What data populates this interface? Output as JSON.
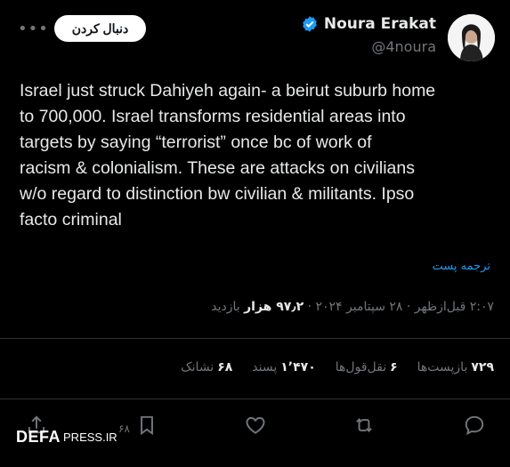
{
  "header": {
    "name": "Noura Erakat",
    "handle": "@4noura",
    "follow_label": "دنبال کردن",
    "more": "•••"
  },
  "tweet": {
    "text": "Israel just struck Dahiyeh again- a beirut suburb home\nto 700,000. Israel transforms residential areas into\ntargets by saying “terrorist” once bc of work of\nracism & colonialism. These are attacks on civilians\nw/o regard to distinction bw civilian & militants. Ipso\nfacto criminal",
    "translate_label": "ترجمه پست"
  },
  "meta": {
    "time_date": "۲:۰۷ قبل‌ازظهر · ۲۸ سپتامبر ۲۰۲۴ · ",
    "views_value": "۹۷٫۲ هزار",
    "views_label": " بازدید"
  },
  "stats": {
    "reposts_value": "۷۲۹",
    "reposts_label": "بازپست‌ها",
    "quotes_value": "۶",
    "quotes_label": "نقل‌قول‌ها",
    "likes_value": "۱٬۴۷۰",
    "likes_label": "پسند",
    "bookmarks_value": "۶۸",
    "bookmarks_label": "نشانک"
  },
  "actions": {
    "bookmark_count": "۶۸"
  },
  "watermark": {
    "defa": "DEFA",
    "press": "PRESS.IR"
  },
  "colors": {
    "background": "#000000",
    "text": "#e7e9ea",
    "muted": "#71767b",
    "link": "#1d9bf0",
    "verified": "#1d9bf0"
  }
}
